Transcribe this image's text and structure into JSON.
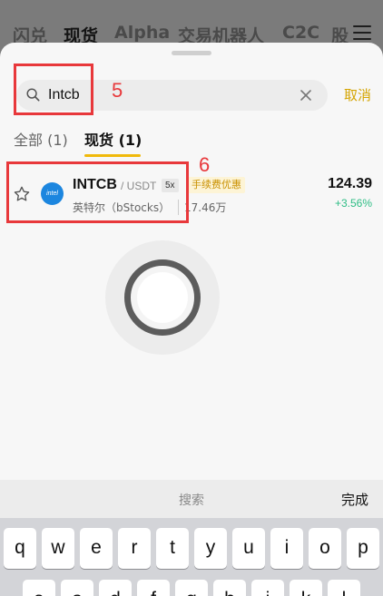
{
  "topnav": {
    "tabs": [
      "闪兑",
      "现货",
      "Alpha",
      "交易机器人",
      "C2C",
      "股"
    ]
  },
  "search": {
    "value": "Intcb",
    "cancel_label": "取消"
  },
  "annotations": {
    "label_5": "5",
    "label_6": "6"
  },
  "filters": {
    "all": "全部 (1)",
    "spot": "现货 (1)"
  },
  "result": {
    "logo_text": "intel",
    "symbol": "INTCB",
    "quote": "/ USDT",
    "leverage": "5x",
    "fee_badge": "手续费优惠",
    "name": "英特尔（bStocks）",
    "volume": "17.46万",
    "price": "124.39",
    "change": "+3.56%",
    "change_color": "#2ebd85"
  },
  "keyboard": {
    "search_label": "搜索",
    "done_label": "完成",
    "row1": [
      "q",
      "w",
      "e",
      "r",
      "t",
      "y",
      "u",
      "i",
      "o",
      "p"
    ],
    "row2": [
      "a",
      "s",
      "d",
      "f",
      "g",
      "h",
      "j",
      "k",
      "l"
    ]
  },
  "colors": {
    "accent": "#f0b90b",
    "annotation": "#e8383b"
  }
}
